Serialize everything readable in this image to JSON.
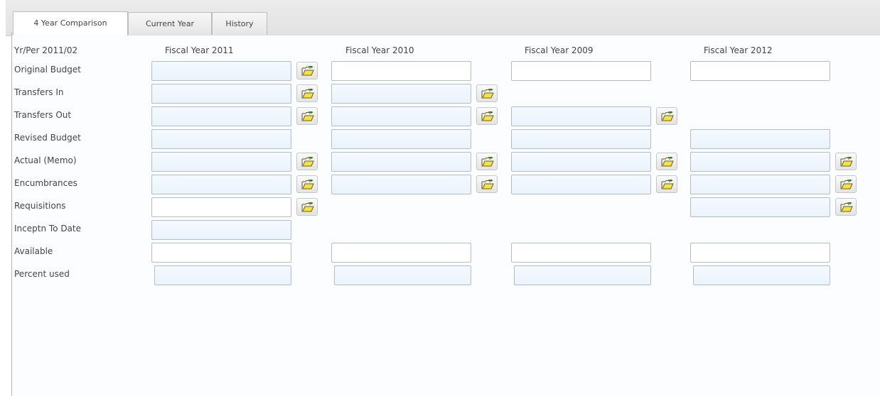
{
  "tabs": [
    "4 Year Comparison",
    "Current Year",
    "History"
  ],
  "period_label": "Yr/Per 2011/02",
  "columns": [
    "Fiscal Year 2011",
    "Fiscal Year 2010",
    "Fiscal Year 2009",
    "Fiscal Year 2012"
  ],
  "rows": [
    {
      "label": "Original Budget",
      "cells": [
        {
          "field": "tinted",
          "btn": true
        },
        {
          "field": "white",
          "btn": false
        },
        {
          "field": "white",
          "btn": false
        },
        {
          "field": "white",
          "btn": false
        }
      ]
    },
    {
      "label": "Transfers In",
      "cells": [
        {
          "field": "tinted",
          "btn": true
        },
        {
          "field": "tinted",
          "btn": true
        },
        {
          "field": null,
          "btn": false
        },
        {
          "field": null,
          "btn": false
        }
      ]
    },
    {
      "label": "Transfers Out",
      "cells": [
        {
          "field": "tinted",
          "btn": true
        },
        {
          "field": "tinted",
          "btn": true
        },
        {
          "field": "tinted",
          "btn": true
        },
        {
          "field": null,
          "btn": false
        }
      ]
    },
    {
      "label": "Revised Budget",
      "cells": [
        {
          "field": "tinted",
          "btn": false
        },
        {
          "field": "tinted",
          "btn": false
        },
        {
          "field": "tinted",
          "btn": false
        },
        {
          "field": "tinted",
          "btn": false
        }
      ]
    },
    {
      "label": "Actual (Memo)",
      "cells": [
        {
          "field": "tinted",
          "btn": true
        },
        {
          "field": "tinted",
          "btn": true
        },
        {
          "field": "tinted",
          "btn": true
        },
        {
          "field": "tinted",
          "btn": true
        }
      ]
    },
    {
      "label": "Encumbrances",
      "cells": [
        {
          "field": "tinted",
          "btn": true
        },
        {
          "field": "tinted",
          "btn": true
        },
        {
          "field": "tinted",
          "btn": true
        },
        {
          "field": "tinted",
          "btn": true
        }
      ]
    },
    {
      "label": "Requisitions",
      "cells": [
        {
          "field": "white",
          "btn": true
        },
        {
          "field": null,
          "btn": false
        },
        {
          "field": null,
          "btn": false
        },
        {
          "field": "tinted",
          "btn": true
        }
      ]
    },
    {
      "label": "Inceptn To Date",
      "cells": [
        {
          "field": "tinted",
          "btn": false
        },
        {
          "field": null,
          "btn": false
        },
        {
          "field": null,
          "btn": false
        },
        {
          "field": null,
          "btn": false
        }
      ]
    },
    {
      "label": "Available",
      "cells": [
        {
          "field": "white",
          "btn": false
        },
        {
          "field": "white",
          "btn": false
        },
        {
          "field": "white",
          "btn": false
        },
        {
          "field": "white",
          "btn": false
        }
      ]
    },
    {
      "label": "Percent used",
      "cells": [
        {
          "field": "tinted",
          "btn": false
        },
        {
          "field": "tinted",
          "btn": false
        },
        {
          "field": "tinted",
          "btn": false
        },
        {
          "field": "tinted",
          "btn": false
        }
      ]
    }
  ],
  "icons": {
    "lookup": "folder-open-icon"
  },
  "colors": {
    "folder_fill": "#f2e34a",
    "folder_outline": "#6b6120",
    "arrow": "#2d6a1f"
  }
}
